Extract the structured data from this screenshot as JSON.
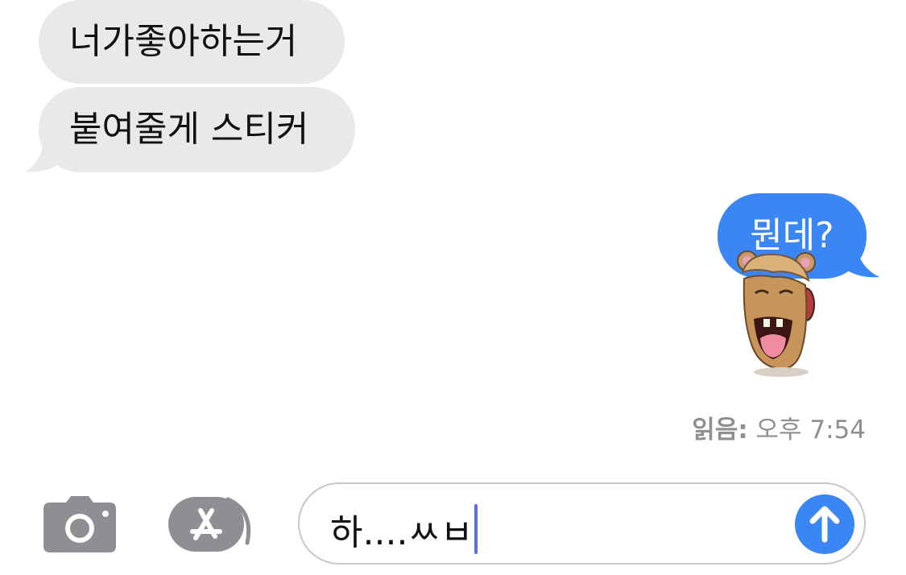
{
  "colors": {
    "incoming_bubble": "#e9e9eb",
    "outgoing_bubble": "#3a86f4",
    "send_button": "#3a86f4",
    "caret": "#5a6cf0",
    "toolbar_icon": "#8e8e93"
  },
  "conversation": {
    "messages": [
      {
        "direction": "incoming",
        "text": "너가좋아하는거"
      },
      {
        "direction": "incoming",
        "text": "붙여줄게 스티커"
      },
      {
        "direction": "outgoing",
        "text": "뭔데?"
      }
    ],
    "sticker": {
      "attached_to": "뭔데?",
      "icon": "laughing-face-sticker"
    },
    "read_receipt": {
      "label": "읽음:",
      "time": "오후 7:54"
    }
  },
  "composer": {
    "camera_icon": "camera-icon",
    "apps_icon": "app-store-icon",
    "draft_text": "하....ㅆㅂ",
    "send_icon": "arrow-up-icon"
  }
}
